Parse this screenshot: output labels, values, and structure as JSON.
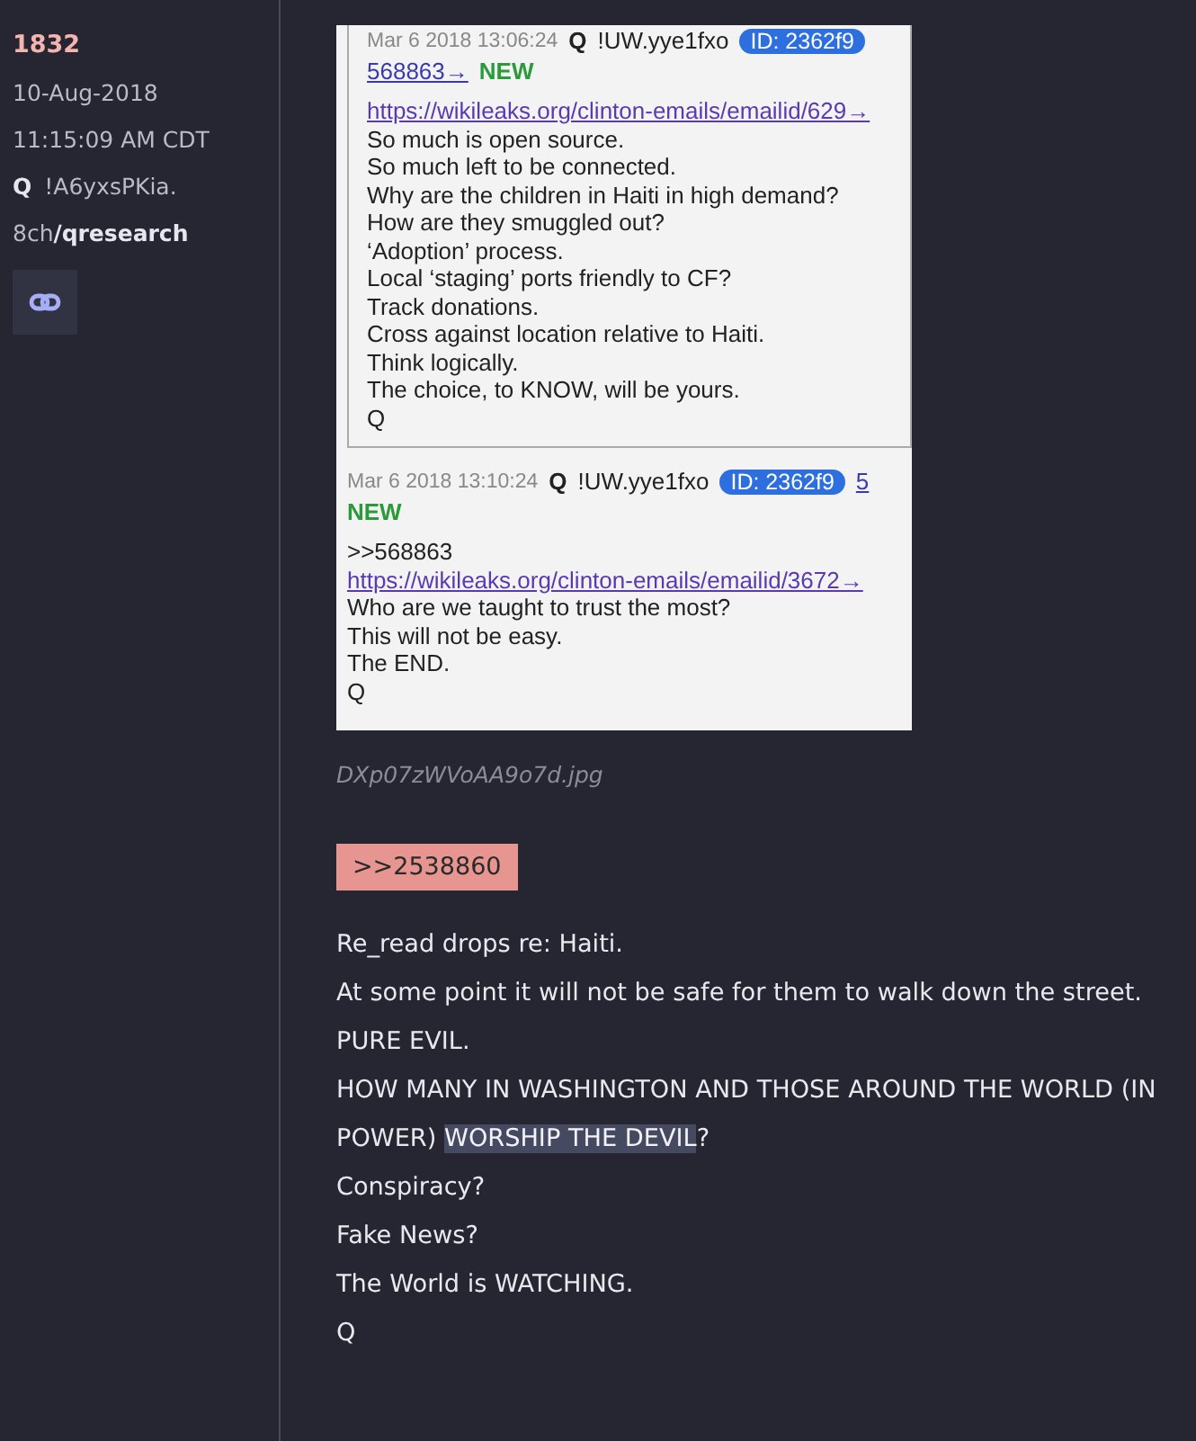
{
  "post": {
    "number": "1832",
    "date": "10-Aug-2018",
    "time": "11:15:09 AM CDT",
    "author": "Q",
    "tripcode": "!A6yxsPKia.",
    "board_prefix": "8ch",
    "board": "/qresearch"
  },
  "image": {
    "filename": "DXp07zWVoAA9o7d.jpg",
    "posts": [
      {
        "boxed": true,
        "timestamp": "Mar 6 2018 13:06:24",
        "author": "Q",
        "tripcode": "!UW.yye1fxo",
        "id": "ID: 2362f9",
        "reply_link": "568863→",
        "new_label": "NEW",
        "lines": [
          {
            "kind": "link",
            "text": "https://wikileaks.org/clinton-emails/emailid/629→"
          },
          {
            "kind": "text",
            "text": "So much is open source."
          },
          {
            "kind": "text",
            "text": "So much left to be connected."
          },
          {
            "kind": "text",
            "text": "Why are the children in Haiti in high demand?"
          },
          {
            "kind": "text",
            "text": "How are they smuggled out?"
          },
          {
            "kind": "text",
            "text": "‘Adoption’ process."
          },
          {
            "kind": "text",
            "text": "Local ‘staging’ ports friendly to CF?"
          },
          {
            "kind": "text",
            "text": "Track donations."
          },
          {
            "kind": "text",
            "text": "Cross against location relative to Haiti."
          },
          {
            "kind": "text",
            "text": "Think logically."
          },
          {
            "kind": "text",
            "text": "The choice, to KNOW, will be yours."
          },
          {
            "kind": "text",
            "text": "Q"
          }
        ]
      },
      {
        "boxed": false,
        "timestamp": "Mar 6 2018 13:10:24",
        "author": "Q",
        "tripcode": "!UW.yye1fxo",
        "id": "ID: 2362f9",
        "reply_link": "5",
        "new_label": "NEW",
        "lines": [
          {
            "kind": "text",
            "text": ">>568863"
          },
          {
            "kind": "link",
            "text": "https://wikileaks.org/clinton-emails/emailid/3672→"
          },
          {
            "kind": "text",
            "text": "Who are we taught to trust the most?"
          },
          {
            "kind": "text",
            "text": "This will not be easy."
          },
          {
            "kind": "text",
            "text": "The END."
          },
          {
            "kind": "text",
            "text": "Q"
          }
        ]
      }
    ]
  },
  "reference": ">>2538860",
  "message": [
    [
      {
        "text": "Re_read drops re: Haiti.",
        "highlight": false
      }
    ],
    [
      {
        "text": "At some point it will not be safe for them to walk down the street.",
        "highlight": false
      }
    ],
    [
      {
        "text": "PURE EVIL.",
        "highlight": false
      }
    ],
    [
      {
        "text": "HOW MANY IN WASHINGTON AND THOSE AROUND THE WORLD (IN POWER) ",
        "highlight": false
      },
      {
        "text": "WORSHIP THE DEVIL",
        "highlight": true
      },
      {
        "text": "?",
        "highlight": false
      }
    ],
    [
      {
        "text": "Conspiracy?",
        "highlight": false
      }
    ],
    [
      {
        "text": "Fake News?",
        "highlight": false
      }
    ],
    [
      {
        "text": "The World is WATCHING.",
        "highlight": false
      }
    ],
    [
      {
        "text": "Q",
        "highlight": false
      }
    ]
  ]
}
